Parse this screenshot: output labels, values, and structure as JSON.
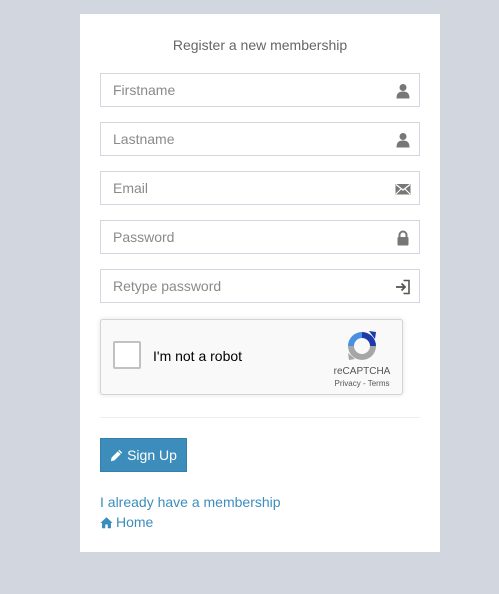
{
  "form": {
    "heading": "Register a new membership",
    "fields": [
      {
        "placeholder": "Firstname",
        "value": "",
        "icon": "user-icon"
      },
      {
        "placeholder": "Lastname",
        "value": "",
        "icon": "user-icon"
      },
      {
        "placeholder": "Email",
        "value": "",
        "icon": "envelope-icon"
      },
      {
        "placeholder": "Password",
        "value": "",
        "icon": "lock-icon"
      },
      {
        "placeholder": "Retype password",
        "value": "",
        "icon": "login-icon"
      }
    ],
    "recaptcha": {
      "label": "I'm not a robot",
      "brand": "reCAPTCHA",
      "links": "Privacy - Terms"
    },
    "signup_label": "Sign Up",
    "membership_link": "I already have a membership",
    "home_link": "Home"
  },
  "colors": {
    "background": "#d2d6de",
    "accent": "#3c8dbc",
    "card": "#ffffff"
  }
}
